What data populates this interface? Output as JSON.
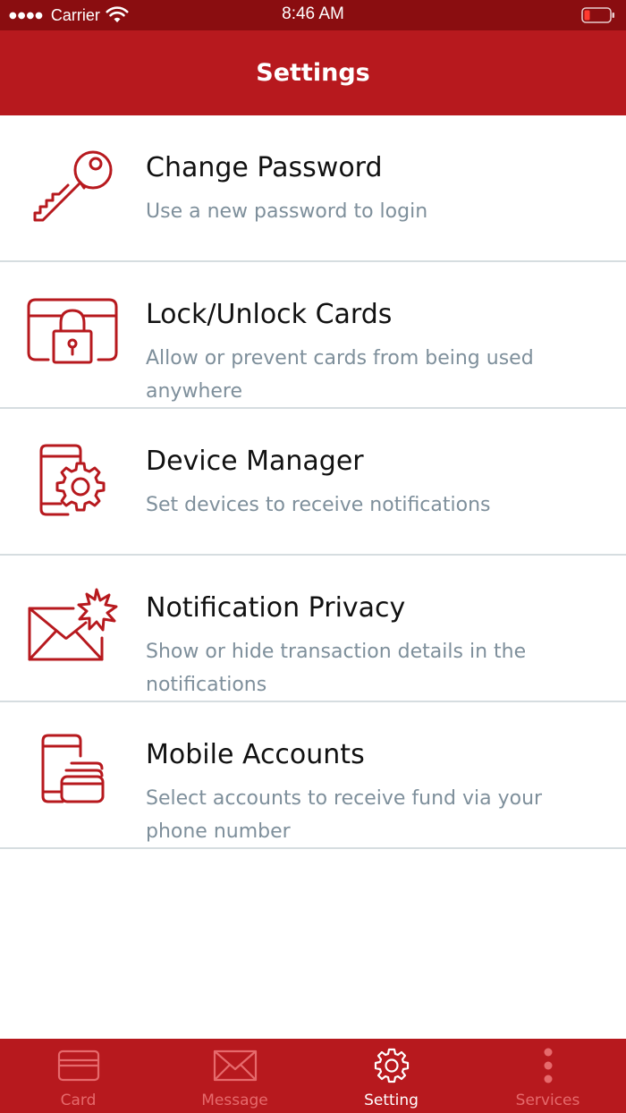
{
  "status_bar": {
    "carrier": "Carrier",
    "time": "8:46 AM"
  },
  "header": {
    "title": "Settings"
  },
  "settings": {
    "items": [
      {
        "title": "Change Password",
        "description": "Use a new password to login",
        "icon": "key-icon"
      },
      {
        "title": "Lock/Unlock Cards",
        "description": "Allow or prevent cards from being used anywhere",
        "icon": "card-lock-icon"
      },
      {
        "title": "Device Manager",
        "description": "Set devices to receive notifications",
        "icon": "device-gear-icon"
      },
      {
        "title": "Notification Privacy",
        "description": "Show or hide transaction details in the notifications",
        "icon": "envelope-alert-icon"
      },
      {
        "title": "Mobile Accounts",
        "description": "Select accounts to receive fund via your phone number",
        "icon": "phone-cards-icon"
      }
    ]
  },
  "tab_bar": {
    "tabs": [
      {
        "label": "Card",
        "icon": "card-icon",
        "active": false
      },
      {
        "label": "Message",
        "icon": "envelope-icon",
        "active": false
      },
      {
        "label": "Setting",
        "icon": "gear-icon",
        "active": true
      },
      {
        "label": "Services",
        "icon": "more-vertical-icon",
        "active": false
      }
    ]
  },
  "colors": {
    "accent": "#b7191e",
    "status_bar": "#8a0d10",
    "description_text": "#7e8f9b",
    "tab_inactive": "#e66a6c",
    "divider": "#d6dde0"
  }
}
